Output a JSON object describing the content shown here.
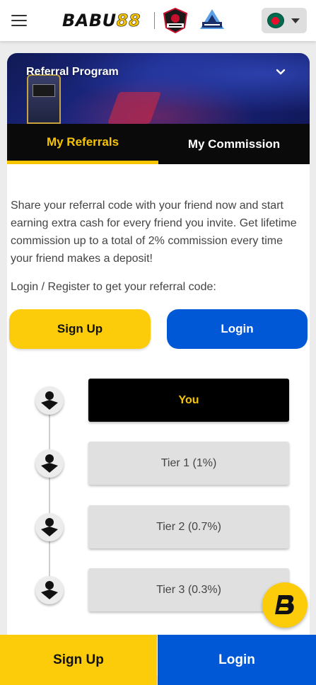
{
  "header": {
    "logo_main": "BABU",
    "logo_accent": "88",
    "partner_1": "Montreal Tigers",
    "partner_2": "Aura",
    "flag_icon": "bangladesh-flag-icon"
  },
  "section": {
    "title": "Referral Program"
  },
  "tabs": [
    {
      "label": "My Referrals",
      "active": true
    },
    {
      "label": "My Commission",
      "active": false
    }
  ],
  "content": {
    "description": "Share your referral code with your friend now and start earning extra cash for every friend you invite. Get lifetime commission up to a total of 2% commission every time your friend makes a deposit!",
    "login_prompt": "Login / Register to get your referral code:",
    "signup_label": "Sign Up",
    "login_label": "Login"
  },
  "tiers": [
    {
      "label": "You"
    },
    {
      "label": "Tier 1 (1%)"
    },
    {
      "label": "Tier 2 (0.7%)"
    },
    {
      "label": "Tier 3 (0.3%)"
    }
  ],
  "bottom_bar": {
    "signup_label": "Sign Up",
    "login_label": "Login"
  },
  "colors": {
    "brand_yellow": "#fccc0a",
    "brand_blue": "#0058d6",
    "tab_bar": "#0a0a0a"
  }
}
